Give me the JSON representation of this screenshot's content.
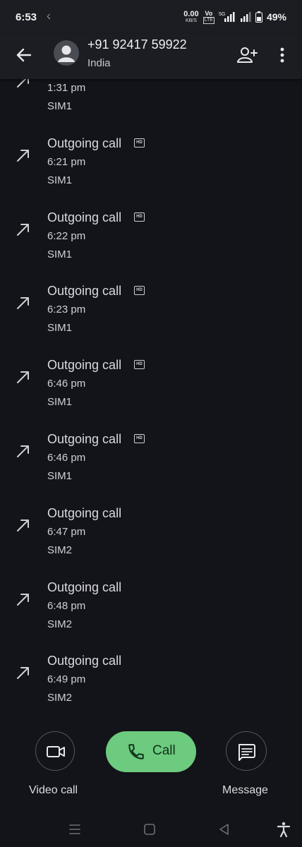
{
  "status_bar": {
    "time": "6:53",
    "net_speed_value": "0.00",
    "net_speed_unit": "KB/S",
    "volte_top": "Vo",
    "volte_bottom": "LTE",
    "network_type": "5G",
    "battery": "49%"
  },
  "header": {
    "contact_number": "+91 92417 59922",
    "contact_country": "India",
    "icons": [
      "back-arrow-icon",
      "avatar-person-icon",
      "add-contact-icon",
      "more-vert-icon"
    ]
  },
  "calls": [
    {
      "type": "Outgoing call",
      "time": "1:31 pm",
      "sim": "SIM1",
      "hd": false
    },
    {
      "type": "Outgoing call",
      "time": "6:21 pm",
      "sim": "SIM1",
      "hd": true
    },
    {
      "type": "Outgoing call",
      "time": "6:22 pm",
      "sim": "SIM1",
      "hd": true
    },
    {
      "type": "Outgoing call",
      "time": "6:23 pm",
      "sim": "SIM1",
      "hd": true
    },
    {
      "type": "Outgoing call",
      "time": "6:46 pm",
      "sim": "SIM1",
      "hd": true
    },
    {
      "type": "Outgoing call",
      "time": "6:46 pm",
      "sim": "SIM1",
      "hd": true
    },
    {
      "type": "Outgoing call",
      "time": "6:47 pm",
      "sim": "SIM2",
      "hd": false
    },
    {
      "type": "Outgoing call",
      "time": "6:48 pm",
      "sim": "SIM2",
      "hd": false
    },
    {
      "type": "Outgoing call",
      "time": "6:49 pm",
      "sim": "SIM2",
      "hd": false
    }
  ],
  "hd_badge": "HD",
  "actions": {
    "video_label": "Video call",
    "call_label": "Call",
    "message_label": "Message",
    "call_color": "#6ccb7e"
  },
  "nav": {
    "icons": [
      "recents-menu-icon",
      "home-square-icon",
      "back-triangle-icon",
      "accessibility-icon"
    ]
  }
}
